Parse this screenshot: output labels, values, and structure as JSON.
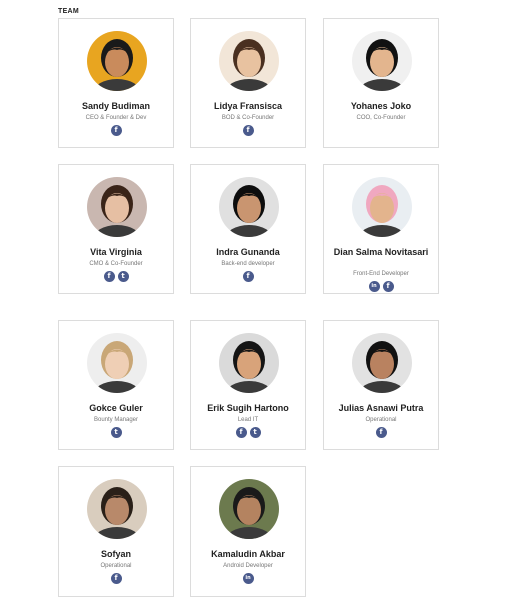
{
  "section_title": "TEAM",
  "colors": {
    "social_icon_bg": "#4a5a8c",
    "card_border": "#dcdcdc"
  },
  "members": [
    {
      "name": "Sandy Budiman",
      "role": "CEO & Founder & Dev",
      "socials": [
        "facebook"
      ],
      "skin": "#c98b5c",
      "hair": "#1a1a1a",
      "bg": "#e8a520"
    },
    {
      "name": "Lidya Fransisca",
      "role": "BOD & Co-Founder",
      "socials": [
        "facebook"
      ],
      "skin": "#e8c2a0",
      "hair": "#4a3020",
      "bg": "#f2e6d8"
    },
    {
      "name": "Yohanes Joko",
      "role": "COO, Co-Founder",
      "socials": [],
      "skin": "#e3b58e",
      "hair": "#111111",
      "bg": "#f0f0f0"
    },
    {
      "name": "Vita Virginia",
      "role": "CMO & Co-Founder",
      "socials": [
        "facebook",
        "twitter"
      ],
      "skin": "#e6bfa3",
      "hair": "#3a2418",
      "bg": "#c9b7b0"
    },
    {
      "name": "Indra Gunanda",
      "role": "Back-end developer",
      "socials": [
        "facebook"
      ],
      "skin": "#c99570",
      "hair": "#0d0d0d",
      "bg": "#e0e0e0"
    },
    {
      "name": "Dian Salma Novitasari",
      "role": "Front-End Developer",
      "socials": [
        "linkedin",
        "facebook"
      ],
      "skin": "#e3b48d",
      "hair": "#f0a8c0",
      "bg": "#e9eef2"
    },
    {
      "name": "Gokce Guler",
      "role": "Bounty Manager",
      "socials": [
        "twitter"
      ],
      "skin": "#efcfb5",
      "hair": "#c9a777",
      "bg": "#eeeeee"
    },
    {
      "name": "Erik Sugih Hartono",
      "role": "Lead IT",
      "socials": [
        "facebook",
        "twitter"
      ],
      "skin": "#d8a37a",
      "hair": "#151515",
      "bg": "#dadada"
    },
    {
      "name": "Julias Asnawi Putra",
      "role": "Operational",
      "socials": [
        "facebook"
      ],
      "skin": "#b98260",
      "hair": "#111111",
      "bg": "#e2e2e2"
    },
    {
      "name": "Sofyan",
      "role": "Operational",
      "socials": [
        "facebook"
      ],
      "skin": "#b8896a",
      "hair": "#2a2018",
      "bg": "#d9cdbe"
    },
    {
      "name": "Kamaludin Akbar",
      "role": "Android Developer",
      "socials": [
        "linkedin"
      ],
      "skin": "#b48360",
      "hair": "#1a1a1a",
      "bg": "#6c7a4e"
    }
  ]
}
